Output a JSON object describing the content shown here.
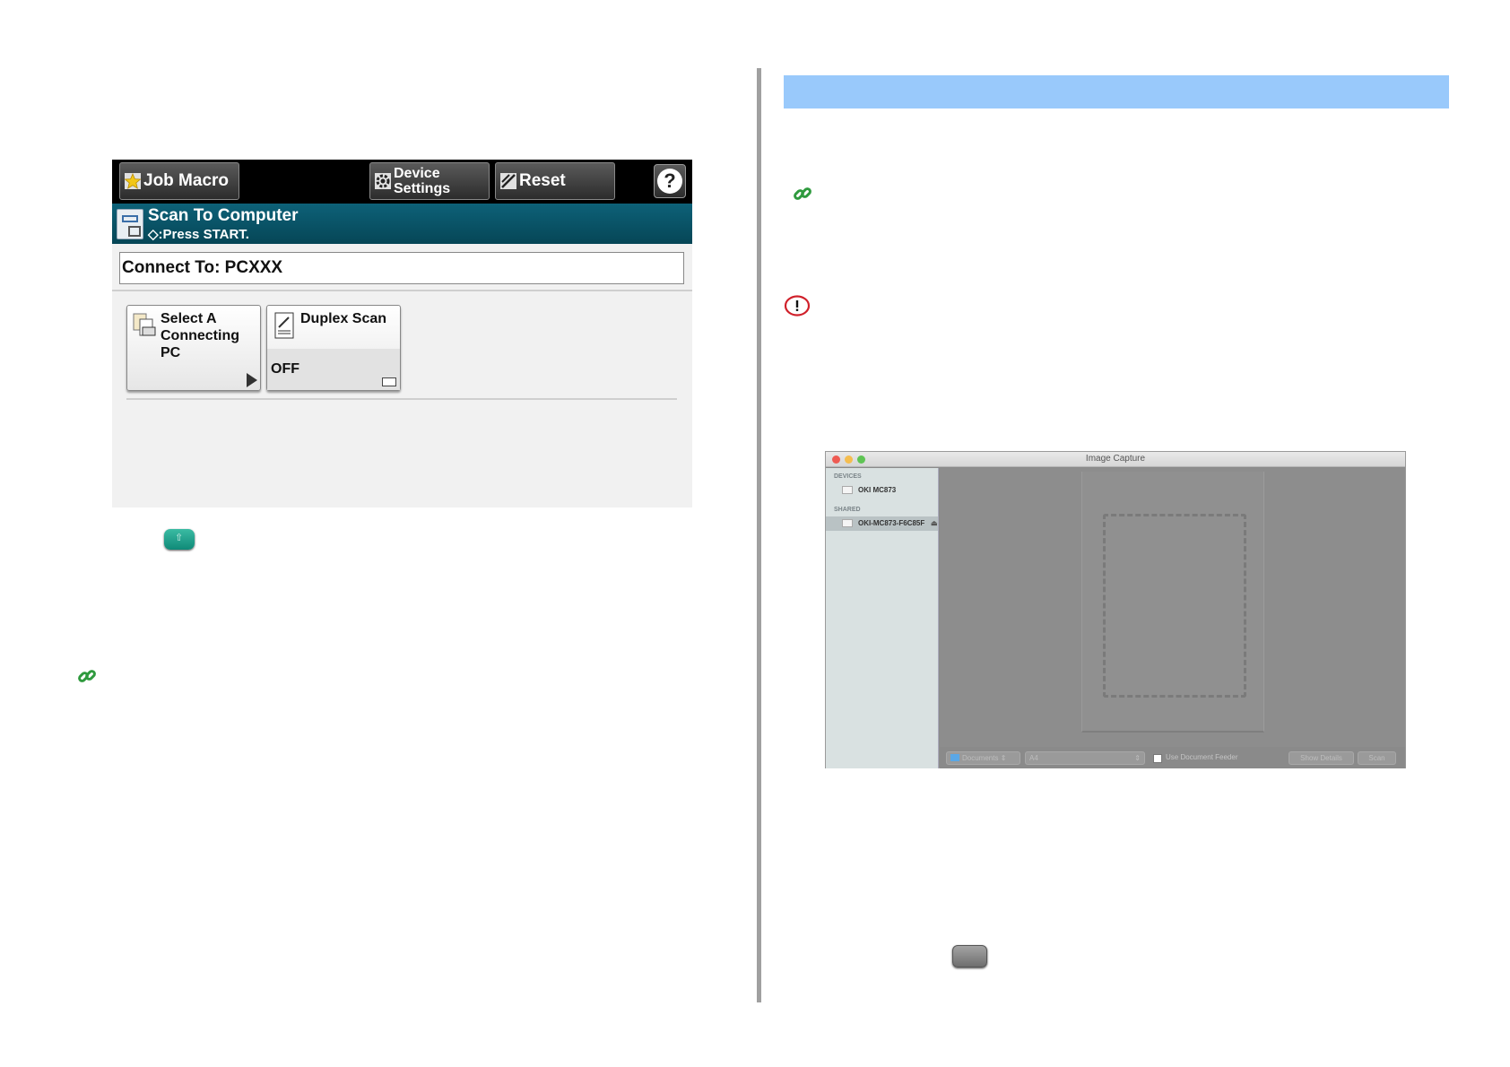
{
  "printer_panel": {
    "topbar": {
      "job_macro": "Job Macro",
      "device_settings_line1": "Device",
      "device_settings_line2": "Settings",
      "reset": "Reset",
      "help": "?"
    },
    "status": {
      "title": "Scan To Computer",
      "subtitle": "◇:Press START."
    },
    "connect_to": "Connect To: PCXXX",
    "buttons": {
      "select_pc_line1": "Select A",
      "select_pc_line2": "Connecting",
      "select_pc_line3": "PC",
      "duplex_label": "Duplex Scan",
      "duplex_value": "OFF"
    }
  },
  "image_capture": {
    "title": "Image Capture",
    "sidebar": {
      "devices_header": "DEVICES",
      "device_1": "OKI MC873",
      "shared_header": "SHARED",
      "shared_1": "OKI-MC873-F6C85F",
      "eject": "⏏"
    },
    "bottom": {
      "folder": "Documents",
      "size": "A4",
      "feeder_label": "Use Document Feeder",
      "show_details": "Show Details",
      "scan": "Scan"
    }
  },
  "colors": {
    "band": "#99c9fb",
    "start_button": "#1b9a86",
    "link_icon": "#2f9a3e",
    "note_icon": "#d0202a"
  },
  "icons": [
    "link-icon",
    "note-icon",
    "start-button-icon",
    "star-icon",
    "gear-icon",
    "reset-icon",
    "help-icon",
    "scan-to-computer-icon",
    "pc-icon",
    "duplex-icon",
    "play-arrow-icon",
    "close-dot",
    "minimize-dot",
    "zoom-dot",
    "scanner-icon",
    "folder-icon"
  ]
}
